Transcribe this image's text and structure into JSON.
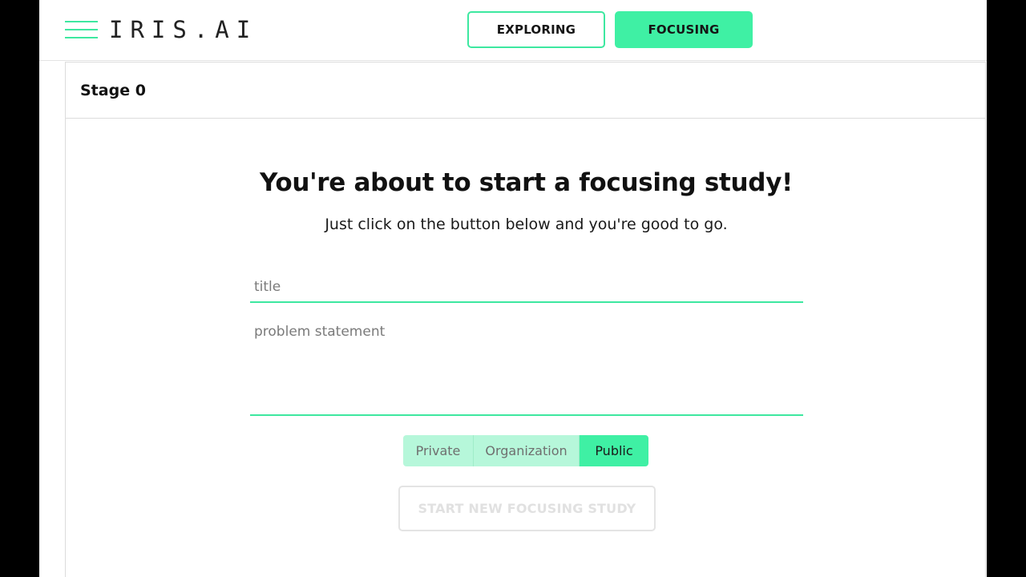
{
  "header": {
    "logo_text": "IRIS.AI",
    "modes": {
      "exploring_label": "EXPLORING",
      "focusing_label": "FOCUSING"
    },
    "active_mode": "FOCUSING"
  },
  "panel": {
    "stage_title": "Stage 0",
    "headline": "You're about to start a focusing study!",
    "subline": "Just click on the button below and you're good to go.",
    "title_input": {
      "value": "",
      "placeholder": "title"
    },
    "problem_input": {
      "value": "",
      "placeholder": "problem statement"
    },
    "visibility": {
      "options": [
        "Private",
        "Organization",
        "Public"
      ],
      "selected": "Public"
    },
    "start_button_label": "START NEW FOCUSING STUDY"
  },
  "colors": {
    "accent": "#3ff0a4",
    "accent_light": "#b6f7da",
    "text": "#111111",
    "disabled": "#e1e1e1"
  },
  "icons": {
    "menu": "hamburger-menu-icon"
  }
}
